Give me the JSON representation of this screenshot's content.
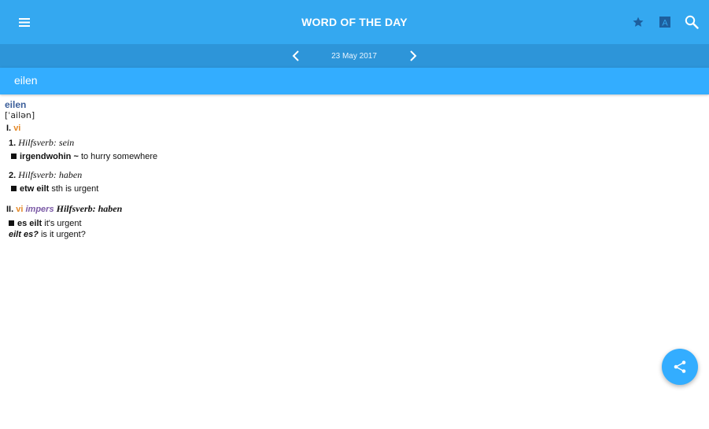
{
  "toolbar": {
    "title": "WORD OF THE DAY",
    "icons": [
      "menu-icon",
      "star-icon",
      "font-icon",
      "search-icon"
    ],
    "font_icon_letter": "A"
  },
  "datebar": {
    "date": "23 May 2017"
  },
  "word": "eilen",
  "entry": {
    "headword": "eilen",
    "phonetic": "[ˈailən]",
    "sense1": {
      "numeral": "I.",
      "pos": "vi",
      "subs": [
        {
          "number": "1.",
          "grammar": "Hilfsverb: sein",
          "example_bold": "irgendwohin ~",
          "example_trans": "to hurry somewhere"
        },
        {
          "number": "2.",
          "grammar": "Hilfsverb: haben",
          "example_bold": "etw eilt",
          "example_trans": "sth is urgent"
        }
      ]
    },
    "sense2": {
      "numeral": "II.",
      "pos": "vi",
      "label": "impers",
      "grammar": "Hilfsverb: haben",
      "example_bold": "es eilt",
      "example_trans": "it's urgent",
      "example2_bold": "eilt es?",
      "example2_trans": "is it urgent?"
    }
  },
  "colors": {
    "toolbar": "#34a8f0",
    "datebar": "#2d95d9",
    "wordbar": "#33adff",
    "headword": "#3b5e9a",
    "pos": "#e58a2a",
    "label": "#7b5aa6"
  },
  "fab": {
    "icon": "share-icon"
  }
}
